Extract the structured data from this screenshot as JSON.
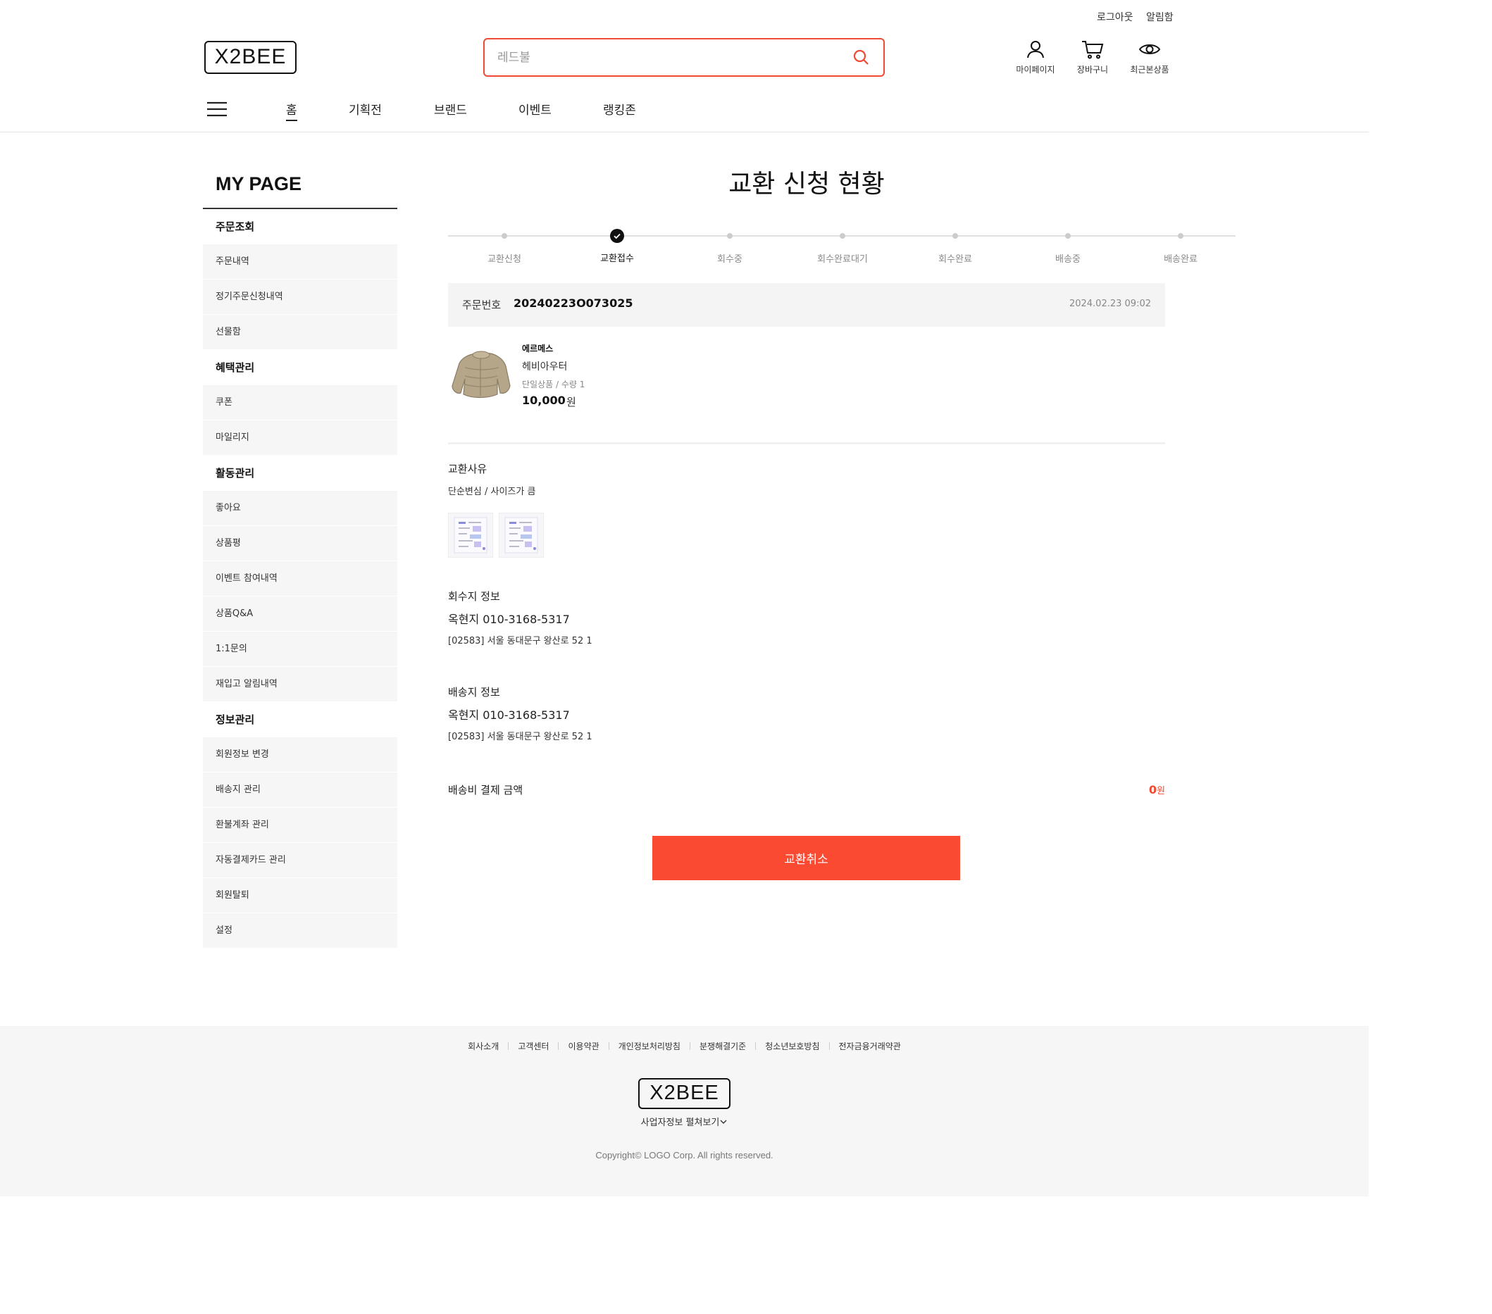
{
  "header": {
    "util_links": [
      "로그아웃",
      "알림함"
    ],
    "logo_text": "X2BEE",
    "search_placeholder": "레드불",
    "icons": [
      {
        "label": "마이페이지",
        "icon": "user-icon"
      },
      {
        "label": "장바구니",
        "icon": "cart-icon"
      },
      {
        "label": "최근본상품",
        "icon": "eye-icon"
      }
    ],
    "nav": [
      "홈",
      "기획전",
      "브랜드",
      "이벤트",
      "랭킹존"
    ]
  },
  "sidebar": {
    "title": "MY PAGE",
    "groups": [
      {
        "title": "주문조회",
        "items": [
          "주문내역",
          "정기주문신청내역",
          "선물함"
        ]
      },
      {
        "title": "혜택관리",
        "items": [
          "쿠폰",
          "마일리지"
        ]
      },
      {
        "title": "활동관리",
        "items": [
          "좋아요",
          "상품평",
          "이벤트 참여내역",
          "상품Q&A",
          "1:1문의",
          "재입고 알림내역"
        ]
      },
      {
        "title": "정보관리",
        "items": [
          "회원정보 변경",
          "배송지 관리",
          "환불계좌 관리",
          "자동결제카드 관리",
          "회원탈퇴",
          "설정"
        ]
      }
    ]
  },
  "main": {
    "title": "교환 신청 현황",
    "steps": [
      "교환신청",
      "교환접수",
      "회수중",
      "회수완료대기",
      "회수완료",
      "배송중",
      "배송완료"
    ],
    "current_step": 1,
    "order": {
      "label": "주문번호",
      "number": "20240223O073025",
      "date": "2024.02.23 09:02"
    },
    "product": {
      "brand": "에르메스",
      "name": "헤비아우터",
      "option": "단일상품 / 수량 1",
      "price": "10,000",
      "currency": "원"
    },
    "reason": {
      "title": "교환사유",
      "text": "단순변심 / 사이즈가 큼"
    },
    "pickup": {
      "title": "회수지 정보",
      "name_phone": "옥현지 010-3168-5317",
      "address": "[02583] 서울 동대문구 왕산로 52 1"
    },
    "shipping": {
      "title": "배송지 정보",
      "name_phone": "옥현지 010-3168-5317",
      "address": "[02583] 서울 동대문구 왕산로 52 1"
    },
    "fee": {
      "label": "배송비 결제 금액",
      "value": "0",
      "unit": "원"
    },
    "cancel_button": "교환취소"
  },
  "footer": {
    "links": [
      "회사소개",
      "고객센터",
      "이용약관",
      "개인정보처리방침",
      "분쟁해결기준",
      "청소년보호방침",
      "전자금융거래약관"
    ],
    "logo_text": "X2BEE",
    "biz_info": "사업자정보 펼쳐보기",
    "copyright": "Copyright© LOGO Corp. All rights reserved."
  },
  "colors": {
    "accent": "#fb4a32",
    "search_border": "#f04a34"
  }
}
